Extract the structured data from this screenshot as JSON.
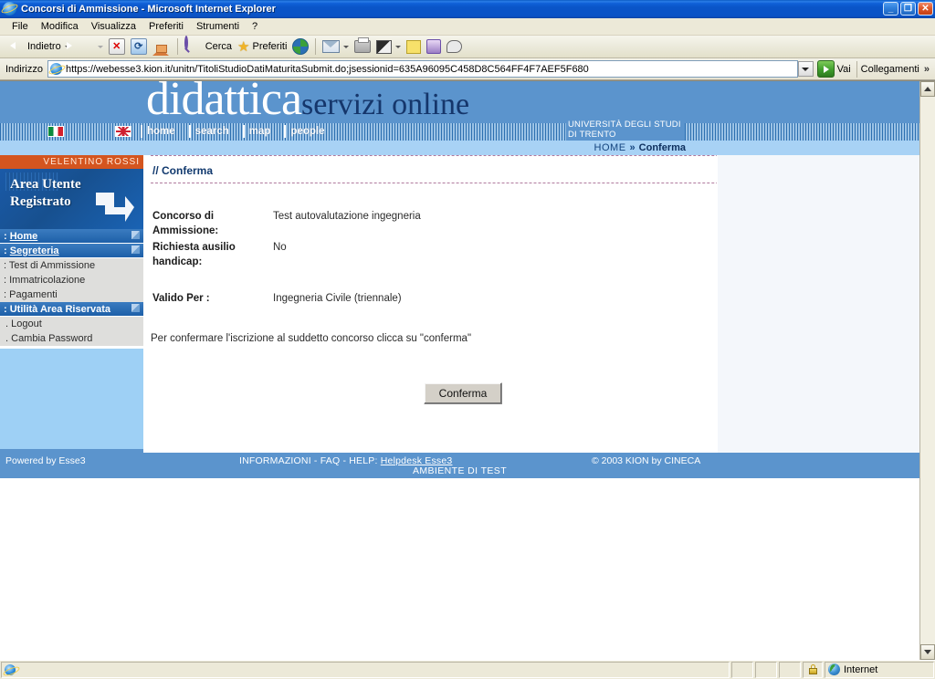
{
  "window": {
    "title": "Concorsi di Ammissione - Microsoft Internet Explorer",
    "icon": "ie-logo-icon",
    "minimize": "_",
    "maximize": "❐",
    "close": "✕"
  },
  "menubar": {
    "items": [
      {
        "label": "File",
        "mnemonic": "F"
      },
      {
        "label": "Modifica",
        "mnemonic": "M"
      },
      {
        "label": "Visualizza",
        "mnemonic": "V"
      },
      {
        "label": "Preferiti",
        "mnemonic": "P"
      },
      {
        "label": "Strumenti",
        "mnemonic": "S"
      },
      {
        "label": "?",
        "mnemonic": "?"
      }
    ]
  },
  "toolbar": {
    "back_label": "Indietro",
    "forward_label": "",
    "stop_label": "",
    "refresh_label": "",
    "home_label": "",
    "search_label": "Cerca",
    "favorites_label": "Preferiti",
    "history_label": "",
    "mail_label": "",
    "print_label": "",
    "edit_label": "",
    "note_label": "",
    "messenger_label": "",
    "discuss_label": ""
  },
  "address": {
    "label": "Indirizzo",
    "url": "https://webesse3.kion.it/unitn/TitoliStudioDatiMaturitaSubmit.do;jsessionid=635A96095C458D8C564FF4F7AEF5F680",
    "go_label": "Vai",
    "links_label": "Collegamenti",
    "links_chevron": "»"
  },
  "site": {
    "brand_primary": "didattica",
    "brand_secondary": "servizi online",
    "university_line1": "UNIVERSITÀ DEGLI STUDI",
    "university_line2": "DI TRENTO",
    "nav": [
      {
        "label": "home"
      },
      {
        "label": "search"
      },
      {
        "label": "map"
      },
      {
        "label": "people"
      }
    ],
    "flags": [
      {
        "name": "italian-flag",
        "alt": "Italiano"
      },
      {
        "name": "uk-flag",
        "alt": "English"
      }
    ],
    "breadcrumb": {
      "root": "HOME",
      "separator": "»",
      "current": "Conferma"
    },
    "colors": {
      "header_blue": "#5b94cd",
      "breadcrumb_blue": "#a8d2f5",
      "user_orange": "#d4551f",
      "menu_blue": "#1d5fa8",
      "menu_gray": "#dededc",
      "sidebar_fill": "#9ed0f5",
      "title_navy": "#11396e",
      "right_panel": "#f4f7fb"
    }
  },
  "sidebar": {
    "user_name": "VELENTINO ROSSI",
    "area_title_line1": "Area Utente",
    "area_title_line2": "Registrato",
    "groups": [
      {
        "header": "Home",
        "prefix": ":",
        "type": "header",
        "items": []
      },
      {
        "header": "Segreteria",
        "prefix": ":",
        "type": "header",
        "items": [
          {
            "prefix": ":",
            "label": "Test di Ammissione"
          },
          {
            "prefix": ":",
            "label": "Immatricolazione"
          },
          {
            "prefix": ":",
            "label": "Pagamenti"
          }
        ]
      },
      {
        "header": "Utilità Area Riservata",
        "prefix": ":",
        "type": "header",
        "items": [
          {
            "prefix": ".",
            "label": "Logout"
          },
          {
            "prefix": ".",
            "label": "Cambia Password"
          }
        ]
      }
    ]
  },
  "main": {
    "section_title": "// Conferma",
    "fields": [
      {
        "label": "Concorso di Ammissione:",
        "value": "Test autovalutazione ingegneria"
      },
      {
        "label": "Richiesta ausilio handicap:",
        "value": "No"
      },
      {
        "label": "Valido Per :",
        "value": "Ingegneria Civile (triennale)"
      }
    ],
    "note": "Per confermare l'iscrizione al suddetto concorso clicca su \"conferma\"",
    "confirm_button": "Conferma"
  },
  "footer": {
    "powered": "Powered by Esse3",
    "info_prefix": "INFORMAZIONI - FAQ - HELP:",
    "info_link": "Helpdesk Esse3",
    "copyright": "© 2003 KION by CINECA",
    "environment": "AMBIENTE DI TEST"
  },
  "statusbar": {
    "message": "",
    "zone": "Internet",
    "lock_icon": "ssl-lock-icon",
    "globe_icon": "globe-icon"
  }
}
